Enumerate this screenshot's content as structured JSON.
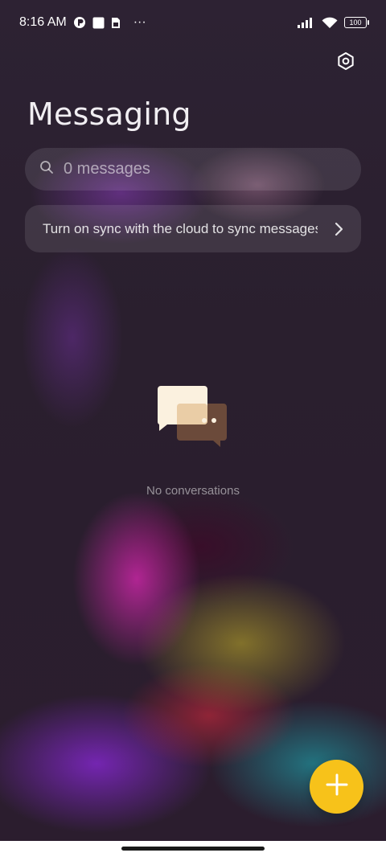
{
  "status_bar": {
    "time": "8:16 AM",
    "overflow": "···",
    "battery": "100",
    "icons": [
      "app-notification-icon",
      "square-notification-icon",
      "sim-notification-icon",
      "signal-icon",
      "wifi-icon",
      "battery-icon"
    ]
  },
  "header": {
    "title": "Messaging",
    "settings_icon": "gear-icon"
  },
  "search": {
    "placeholder": "0 messages",
    "icon": "search-icon"
  },
  "sync_banner": {
    "text": "Turn on sync with the cloud to sync messages",
    "icon": "chevron-right-icon"
  },
  "empty_state": {
    "icon": "conversation-bubbles-icon",
    "text": "No conversations"
  },
  "fab": {
    "icon": "plus-icon",
    "color": "#f7c21a"
  }
}
